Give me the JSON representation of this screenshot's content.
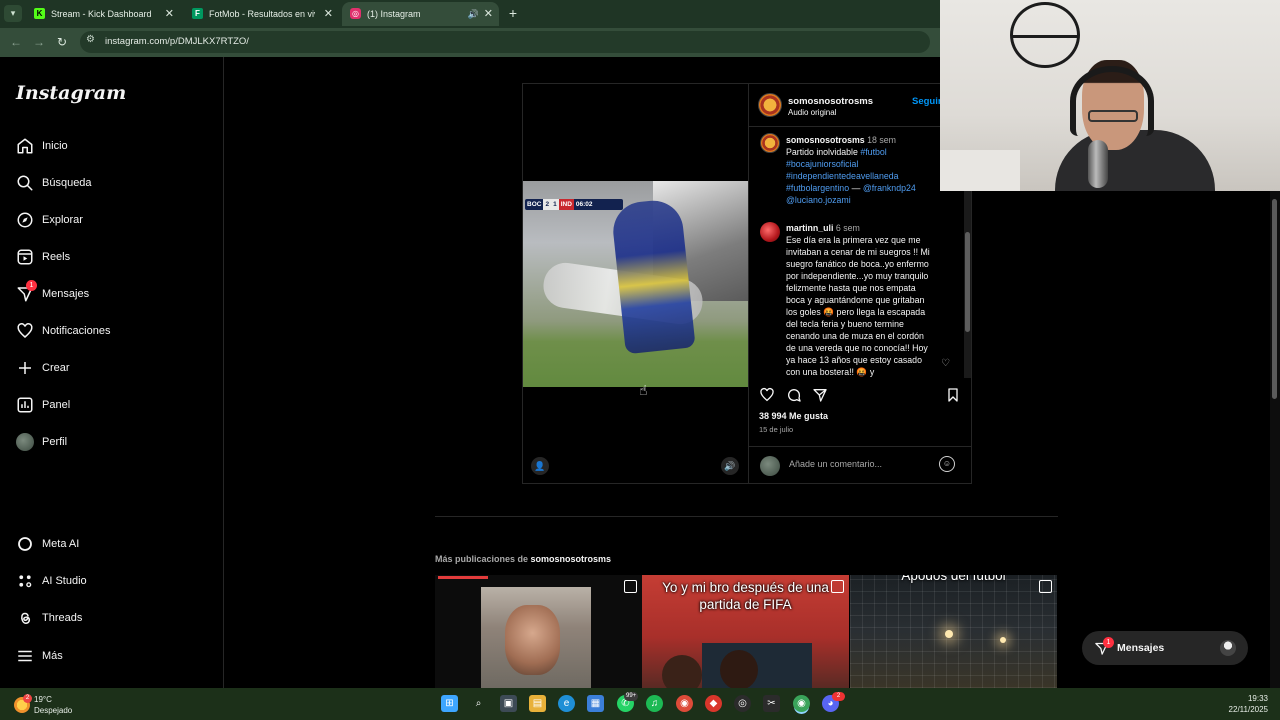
{
  "browser": {
    "tabs": [
      {
        "title": "Stream - Kick Dashboard",
        "favicon": "K",
        "favicon_color": "#53fc18"
      },
      {
        "title": "FotMob - Resultados en vivo de",
        "favicon": "F",
        "favicon_color": "#00985f"
      },
      {
        "title": "(1) Instagram",
        "favicon": "◎",
        "favicon_color": "#e1306c",
        "active": true
      }
    ],
    "new_tab": "+",
    "url": "instagram.com/p/DMJLKX7RTZO/"
  },
  "sidebar": {
    "logo": "Instagram",
    "items": [
      {
        "label": "Inicio",
        "icon": "home-icon"
      },
      {
        "label": "Búsqueda",
        "icon": "search-icon"
      },
      {
        "label": "Explorar",
        "icon": "compass-icon"
      },
      {
        "label": "Reels",
        "icon": "reels-icon"
      },
      {
        "label": "Mensajes",
        "icon": "messenger-icon",
        "badge": "1"
      },
      {
        "label": "Notificaciones",
        "icon": "heart-icon"
      },
      {
        "label": "Crear",
        "icon": "plus-icon"
      },
      {
        "label": "Panel",
        "icon": "dashboard-icon"
      },
      {
        "label": "Perfil",
        "icon": "avatar-icon"
      }
    ],
    "bottom_items": [
      {
        "label": "Meta AI",
        "icon": "meta-ai-icon"
      },
      {
        "label": "AI Studio",
        "icon": "ai-studio-icon"
      },
      {
        "label": "Threads",
        "icon": "threads-icon"
      },
      {
        "label": "Más",
        "icon": "menu-icon"
      }
    ]
  },
  "post": {
    "video": {
      "scorebug": {
        "home": "BOC",
        "home_score": "2",
        "away_score": "1",
        "away": "IND",
        "clock": "06:02"
      }
    },
    "header": {
      "username": "somosnosotrosms",
      "subtitle": "Audio original",
      "follow": "Seguir"
    },
    "caption": {
      "username": "somosnosotrosms",
      "time": "18 sem",
      "text": "Partido inolvidable",
      "tags": [
        "#futbol",
        "#bocajuniorsoficial",
        "#independientedeavellaneda",
        "#futbolargentino"
      ],
      "dash": "—",
      "mentions": [
        "@frankndp24",
        "@luciano.jozami"
      ]
    },
    "comment": {
      "username": "martinn_uli",
      "time": "6 sem",
      "text": "Ese día era la primera vez que me invitaban a cenar de mi suegros !! Mi suegro fanático de boca..yo enfermo por independiente...yo muy tranquilo felizmente hasta que nos empata boca y aguantándome que gritaban los goles 🤬 pero llega la escapada del tecla feria y bueno termine cenando una de muza en el cordón de una vereda que no conocía!! Hoy ya hace 13 años que estoy casado con una bostera!! 🤬 y"
    },
    "likes": "38 994 Me gusta",
    "date": "15 de julio",
    "comment_placeholder": "Añade un comentario..."
  },
  "more": {
    "title_prefix": "Más publicaciones de",
    "title_user": "somosnosotrosms",
    "thumbs": [
      {
        "caption": ""
      },
      {
        "caption": "Yo y mi bro después de una partida de FIFA"
      },
      {
        "caption": "Apodos del fútbol"
      }
    ]
  },
  "floating": {
    "label": "Mensajes",
    "badge": "1"
  },
  "taskbar": {
    "weather": {
      "temp": "19°C",
      "desc": "Despejado",
      "badge": "2"
    },
    "whatsapp_badge": "99+",
    "discord_badge": "2",
    "time": "19:33",
    "date": "22/11/2025"
  },
  "colors": {
    "accent": "#0095f6",
    "link": "#4f9cf0",
    "badge": "#ff3040",
    "tabbar": "#1f3525",
    "taskbar": "#1c3019"
  }
}
